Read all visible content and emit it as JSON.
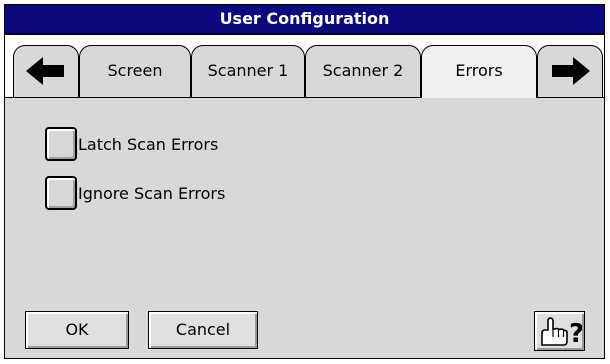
{
  "window": {
    "title": "User Configuration"
  },
  "tabs": [
    {
      "label": "Screen",
      "active": false
    },
    {
      "label": "Scanner 1",
      "active": false
    },
    {
      "label": "Scanner 2",
      "active": false
    },
    {
      "label": "Errors",
      "active": true
    }
  ],
  "nav": {
    "prev_icon": "arrow-left-icon",
    "next_icon": "arrow-right-icon"
  },
  "options": [
    {
      "label": "Latch Scan Errors",
      "checked": false
    },
    {
      "label": "Ignore Scan Errors",
      "checked": false
    }
  ],
  "buttons": {
    "ok_label": "OK",
    "cancel_label": "Cancel",
    "help_icon": "help-hand-question-icon"
  },
  "colors": {
    "titlebar": "#0a0a7e",
    "panel": "#d8d8d8",
    "title_text": "#ffffff"
  }
}
